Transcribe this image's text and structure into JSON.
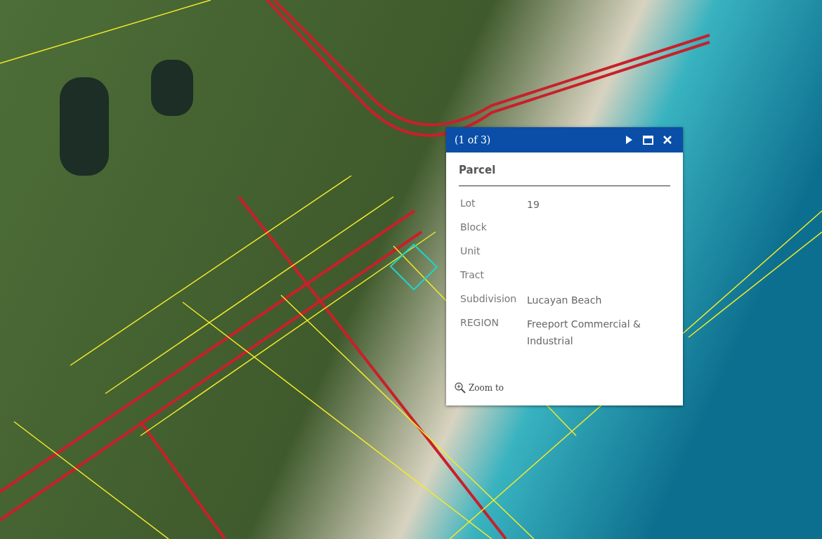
{
  "popup": {
    "pager": "(1 of 3)",
    "title": "Parcel",
    "fields": [
      {
        "label": "Lot",
        "value": "19"
      },
      {
        "label": "Block"
      },
      {
        "label": "Unit"
      },
      {
        "label": "Tract"
      },
      {
        "label": "Subdivision",
        "value": "Lucayan Beach"
      },
      {
        "label": "REGION",
        "value": "Freeport Commercial & Industrial"
      }
    ],
    "zoom_link": "Zoom to"
  }
}
